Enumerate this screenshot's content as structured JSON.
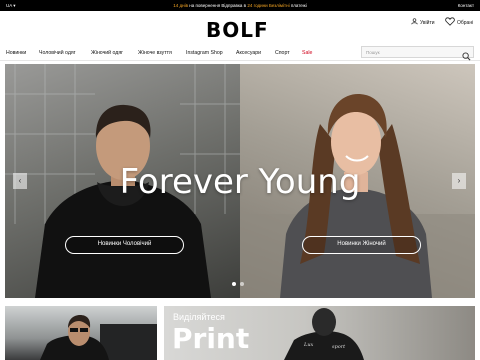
{
  "topbar": {
    "lang": "UA",
    "promo_part1": "14 днів",
    "promo_part2": " на повернення     Відправка в ",
    "promo_part3": "24 години",
    "promo_part4": "     ",
    "promo_part5": "Безлімітні",
    "promo_part6": " платежі",
    "contact": "Контакт"
  },
  "header": {
    "logo": "BOLF",
    "login": "Увійти",
    "favorites": "Обрані"
  },
  "nav": {
    "items": [
      "Новинки",
      "Чоловічий одяг",
      "Жіночий одяг",
      "Жіноче взуття",
      "Instagram Shop",
      "Аксесуари",
      "Спорт",
      "Sale"
    ]
  },
  "search": {
    "placeholder": "Пошук"
  },
  "hero": {
    "headline": "Forever Young",
    "cta_men": "Новинки Чоловічий",
    "cta_women": "Новинки Жіночий"
  },
  "promo2": {
    "line1": "Виділяйтеся",
    "line2": "Print"
  },
  "icons": {
    "login": "user-icon",
    "favorites": "heart-icon",
    "search": "search-icon",
    "prev": "chevron-left-icon",
    "next": "chevron-right-icon"
  },
  "colors": {
    "accent_orange": "#f6a623",
    "sale_red": "#d0021b"
  }
}
